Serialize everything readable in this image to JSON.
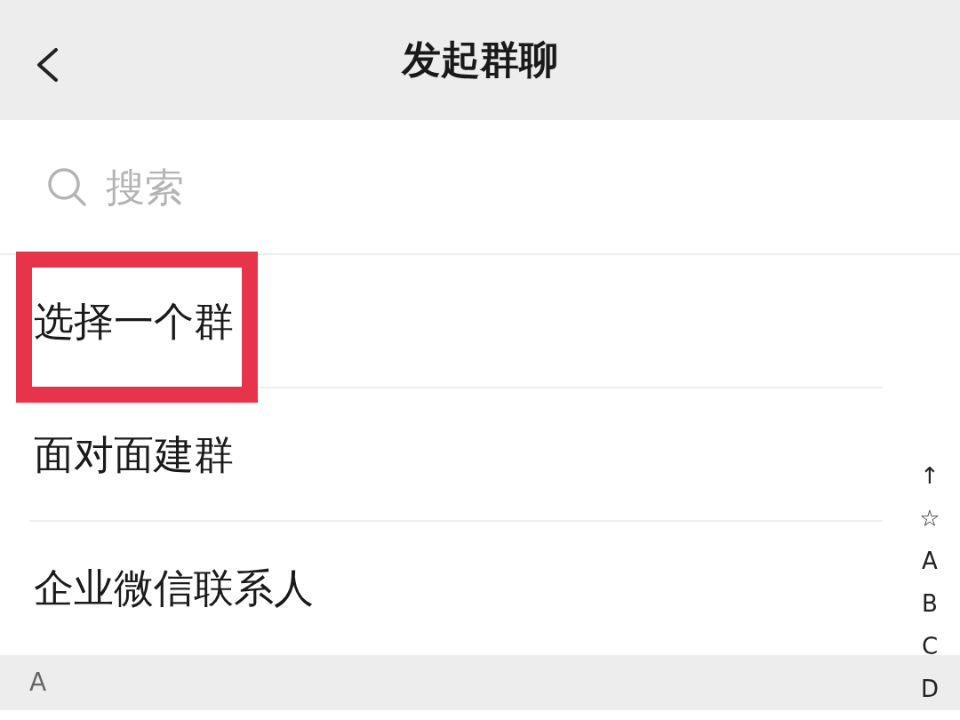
{
  "header": {
    "title": "发起群聊"
  },
  "search": {
    "placeholder": "搜索"
  },
  "menu_items": [
    {
      "label": "选择一个群",
      "highlighted": true
    },
    {
      "label": "面对面建群",
      "highlighted": false
    },
    {
      "label": "企业微信联系人",
      "highlighted": false
    }
  ],
  "section_header": {
    "label": "A"
  },
  "index_bar": [
    "↑",
    "☆",
    "A",
    "B",
    "C",
    "D"
  ]
}
